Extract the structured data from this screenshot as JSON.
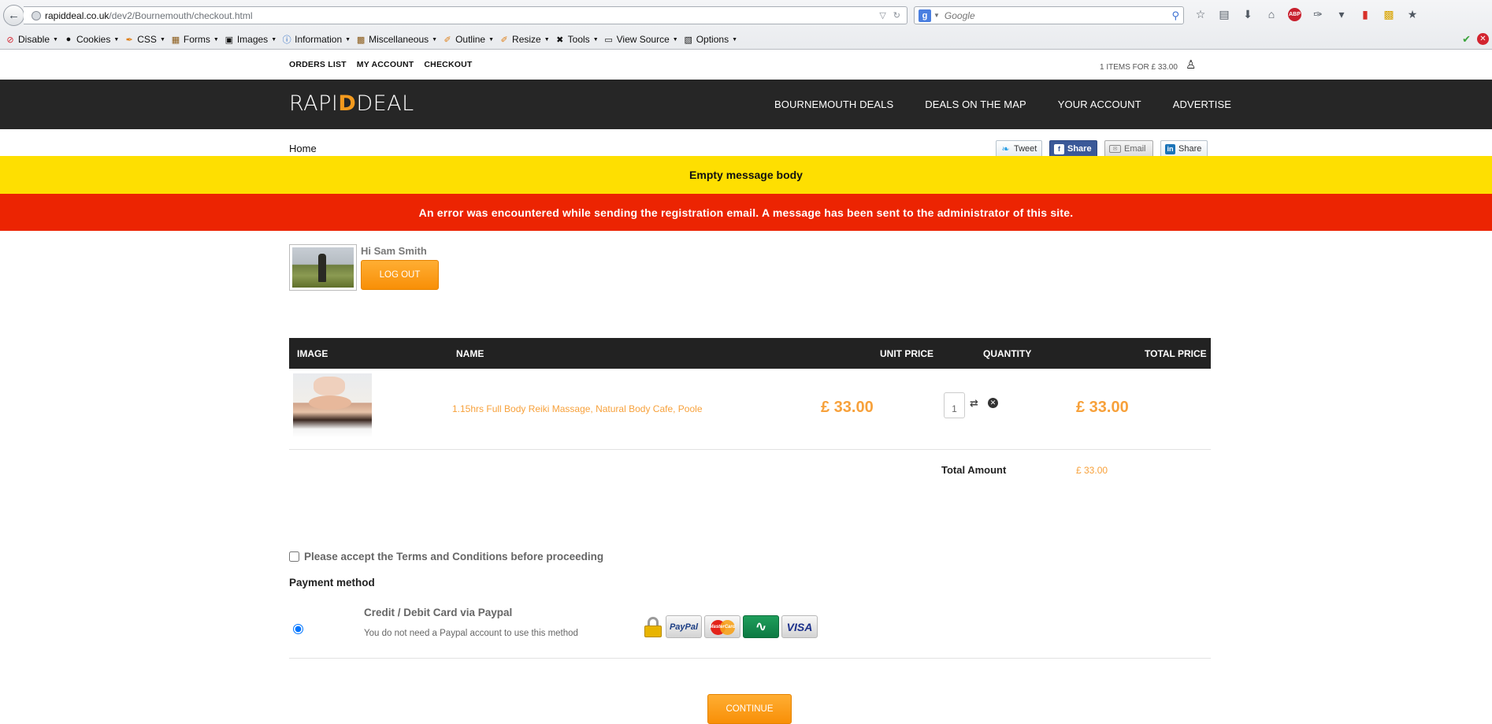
{
  "browser": {
    "url_host": "rapiddeal.co.uk",
    "url_path": "/dev2/Bournemouth/checkout.html",
    "search_placeholder": "Google",
    "dev_toolbar": [
      {
        "label": "Disable",
        "icon": "disable-icon"
      },
      {
        "label": "Cookies",
        "icon": "cookies-icon"
      },
      {
        "label": "CSS",
        "icon": "css-icon"
      },
      {
        "label": "Forms",
        "icon": "forms-icon"
      },
      {
        "label": "Images",
        "icon": "images-icon"
      },
      {
        "label": "Information",
        "icon": "information-icon"
      },
      {
        "label": "Miscellaneous",
        "icon": "miscellaneous-icon"
      },
      {
        "label": "Outline",
        "icon": "outline-icon"
      },
      {
        "label": "Resize",
        "icon": "resize-icon"
      },
      {
        "label": "Tools",
        "icon": "tools-icon"
      },
      {
        "label": "View Source",
        "icon": "view-source-icon"
      },
      {
        "label": "Options",
        "icon": "options-icon"
      }
    ],
    "abp_badge": "ABP"
  },
  "topbar": {
    "links": [
      "ORDERS LIST",
      "MY ACCOUNT",
      "CHECKOUT"
    ],
    "cart_summary": "1 ITEMS FOR £ 33.00"
  },
  "header": {
    "logo_left": "RAPI",
    "logo_mark": "D",
    "logo_right": "DEAL",
    "nav": [
      "BOURNEMOUTH DEALS",
      "DEALS ON THE MAP",
      "YOUR ACCOUNT",
      "ADVERTISE"
    ]
  },
  "breadcrumb": "Home",
  "share": {
    "tweet": "Tweet",
    "facebook": "Share",
    "email": "Email",
    "linkedin": "Share"
  },
  "messages": {
    "warning": "Empty message body",
    "error": "An error was encountered while sending the registration email. A message has been sent to the administrator of this site."
  },
  "user": {
    "greeting": "Hi Sam Smith",
    "logout_label": "LOG OUT"
  },
  "cart": {
    "columns": [
      "IMAGE",
      "NAME",
      "UNIT PRICE",
      "QUANTITY",
      "TOTAL PRICE"
    ],
    "items": [
      {
        "name": "1.15hrs Full Body Reiki Massage, Natural Body Cafe, Poole",
        "unit_price": "£ 33.00",
        "quantity": "1",
        "total_price": "£ 33.00"
      }
    ],
    "total_label": "Total Amount",
    "total_value": "£ 33.00"
  },
  "terms_label": "Please accept the Terms and Conditions before proceeding",
  "payment": {
    "title": "Payment method",
    "method_name": "Credit / Debit Card via Paypal",
    "method_desc": "You do not need a Paypal account to use this method",
    "cards": {
      "paypal": "PayPal",
      "mastercard": "MasterCard",
      "visa": "VISA"
    }
  },
  "continue_label": "CONTINUE",
  "colors": {
    "accent_orange": "#f88f07",
    "warning_yellow": "#fedf01",
    "error_red": "#ec2402",
    "header_dark": "#262626"
  }
}
